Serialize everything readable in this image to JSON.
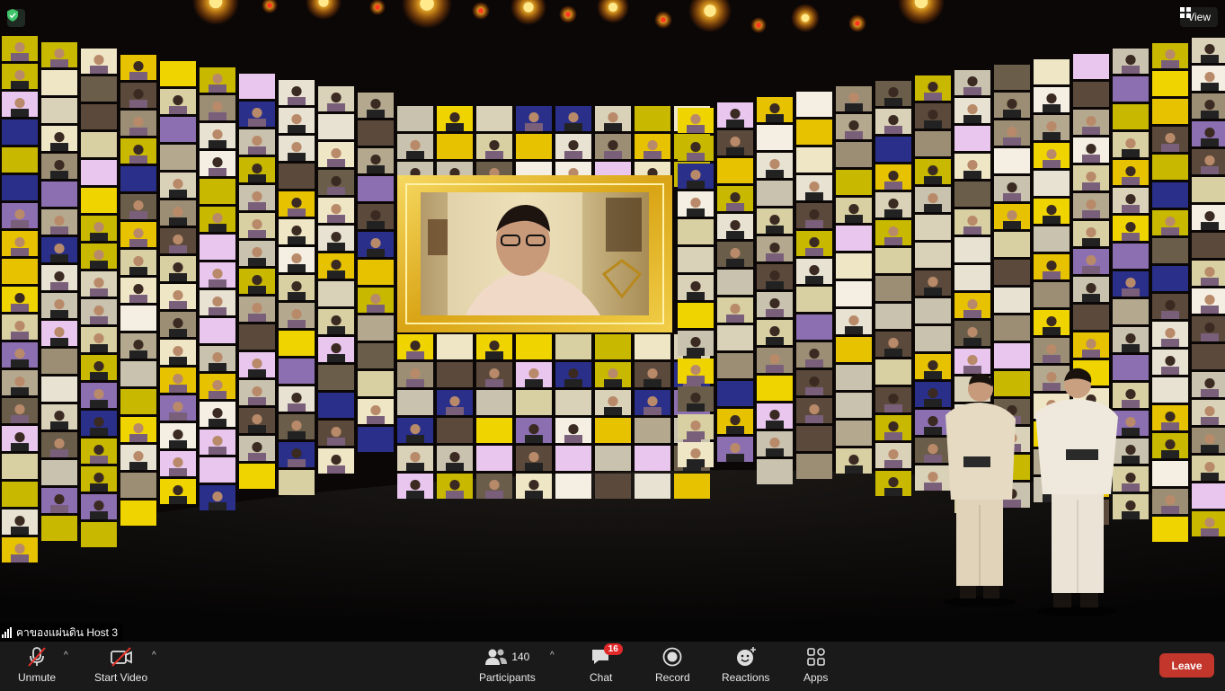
{
  "meeting": {
    "speaker_name": "คาของแผ่นดิน Host 3"
  },
  "top_right": {
    "view_label": "View"
  },
  "toolbar": {
    "unmute_label": "Unmute",
    "start_video_label": "Start Video",
    "participants_label": "Participants",
    "participants_count": "140",
    "chat_label": "Chat",
    "chat_badge": "16",
    "record_label": "Record",
    "reactions_label": "Reactions",
    "apps_label": "Apps",
    "leave_label": "Leave"
  },
  "colors": {
    "toolbar_bg": "#1a1a1a",
    "leave_red": "#c2362c",
    "badge_red": "#e02828",
    "frame_gold": "#e1b320",
    "security_green": "#3fc46a"
  },
  "icons": [
    "shield-icon",
    "view-grid-icon",
    "signal-icon",
    "mic-muted-icon",
    "video-off-icon",
    "participants-icon",
    "chat-icon",
    "record-icon",
    "reactions-icon",
    "apps-icon"
  ]
}
